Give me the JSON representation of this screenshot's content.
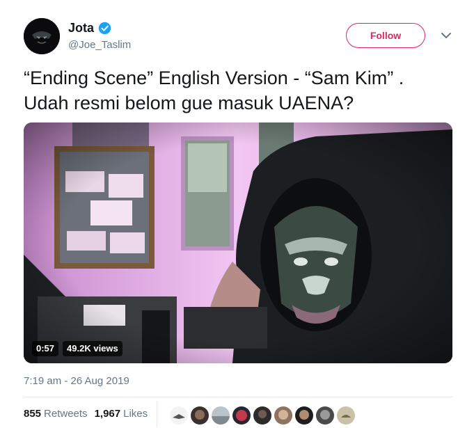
{
  "user": {
    "name": "Jota",
    "handle": "@Joe_Taslim",
    "verified_icon": "verified-badge-icon",
    "avatar_icon": "avatar-icon"
  },
  "follow_label": "Follow",
  "menu_icon": "chevron-down-icon",
  "tweet": {
    "text": "“Ending Scene” English Version - “Sam Kim” .\nUdah resmi belom gue masuk UAENA?"
  },
  "video": {
    "duration": "0:57",
    "views": "49.2K views"
  },
  "timestamp": "7:19 am - 26 Aug 2019",
  "stats": {
    "retweets_count": "855",
    "retweets_label": "Retweets",
    "likes_count": "1,967",
    "likes_label": "Likes"
  },
  "colors": {
    "follow_accent": "#e0245e",
    "verified_blue": "#1da1f2",
    "secondary_text": "#657786"
  }
}
